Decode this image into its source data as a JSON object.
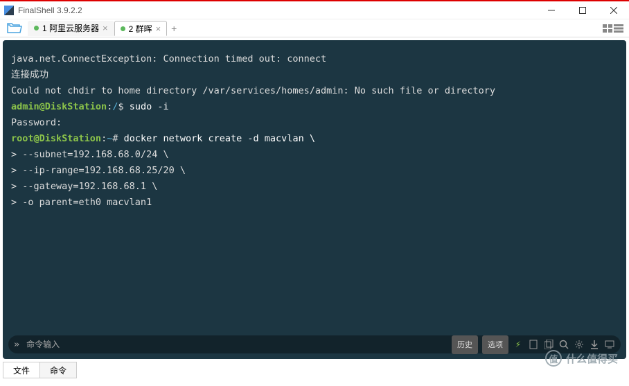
{
  "window": {
    "title": "FinalShell 3.9.2.2",
    "minimize": "—",
    "maximize": "☐",
    "close": "✕"
  },
  "tabs": {
    "items": [
      {
        "dot": "green",
        "label": "1 阿里云服务器",
        "active": false
      },
      {
        "dot": "green",
        "label": "2 群晖",
        "active": true
      }
    ],
    "add": "+"
  },
  "terminal": {
    "lines": [
      {
        "type": "plain",
        "text": "java.net.ConnectException: Connection timed out: connect"
      },
      {
        "type": "plain",
        "text": "连接成功"
      },
      {
        "type": "plain",
        "text": "Could not chdir to home directory /var/services/homes/admin: No such file or directory"
      },
      {
        "type": "prompt",
        "user": "admin",
        "host": "DiskStation",
        "path": "/",
        "symbol": "$",
        "cmd": "sudo -i"
      },
      {
        "type": "plain",
        "text": "Password:"
      },
      {
        "type": "prompt",
        "user": "root",
        "host": "DiskStation",
        "path": "~",
        "symbol": "#",
        "cmd": "docker network create -d macvlan \\"
      },
      {
        "type": "cont",
        "text": "> --subnet=192.168.68.0/24 \\"
      },
      {
        "type": "cont",
        "text": "> --ip-range=192.168.68.25/20 \\"
      },
      {
        "type": "cont",
        "text": "> --gateway=192.168.68.1 \\"
      },
      {
        "type": "cont",
        "text": "> -o parent=eth0 macvlan1"
      }
    ],
    "input_placeholder": "命令输入",
    "history_btn": "历史",
    "options_btn": "选项"
  },
  "bottom_tabs": {
    "items": [
      {
        "label": "文件",
        "active": true
      },
      {
        "label": "命令",
        "active": false
      }
    ]
  },
  "watermark": {
    "logo": "值",
    "text": "什么值得买"
  }
}
